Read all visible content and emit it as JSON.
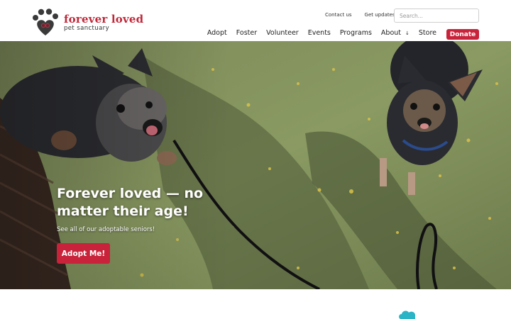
{
  "brand": {
    "name": "forever loved",
    "tagline": "pet sanctuary",
    "accent": "#c8233a",
    "logo_icon": "paw-heart-icon"
  },
  "utility_links": [
    {
      "label": "Contact us"
    },
    {
      "label": "Get updates"
    }
  ],
  "search": {
    "placeholder": "Search...",
    "value": ""
  },
  "nav": {
    "items": [
      {
        "label": "Adopt"
      },
      {
        "label": "Foster"
      },
      {
        "label": "Volunteer"
      },
      {
        "label": "Events"
      },
      {
        "label": "Programs"
      },
      {
        "label": "About",
        "has_dropdown": true
      },
      {
        "label": "Store"
      }
    ],
    "donate_label": "Donate"
  },
  "hero": {
    "title": "Forever loved — no matter their age!",
    "subtitle": "See all of our adoptable seniors!",
    "cta_label": "Adopt Me!",
    "image_subject": "two senior dogs on grass on a leash"
  },
  "colors": {
    "button": "#c8233a",
    "teal_mark": "#2bb3c6"
  }
}
